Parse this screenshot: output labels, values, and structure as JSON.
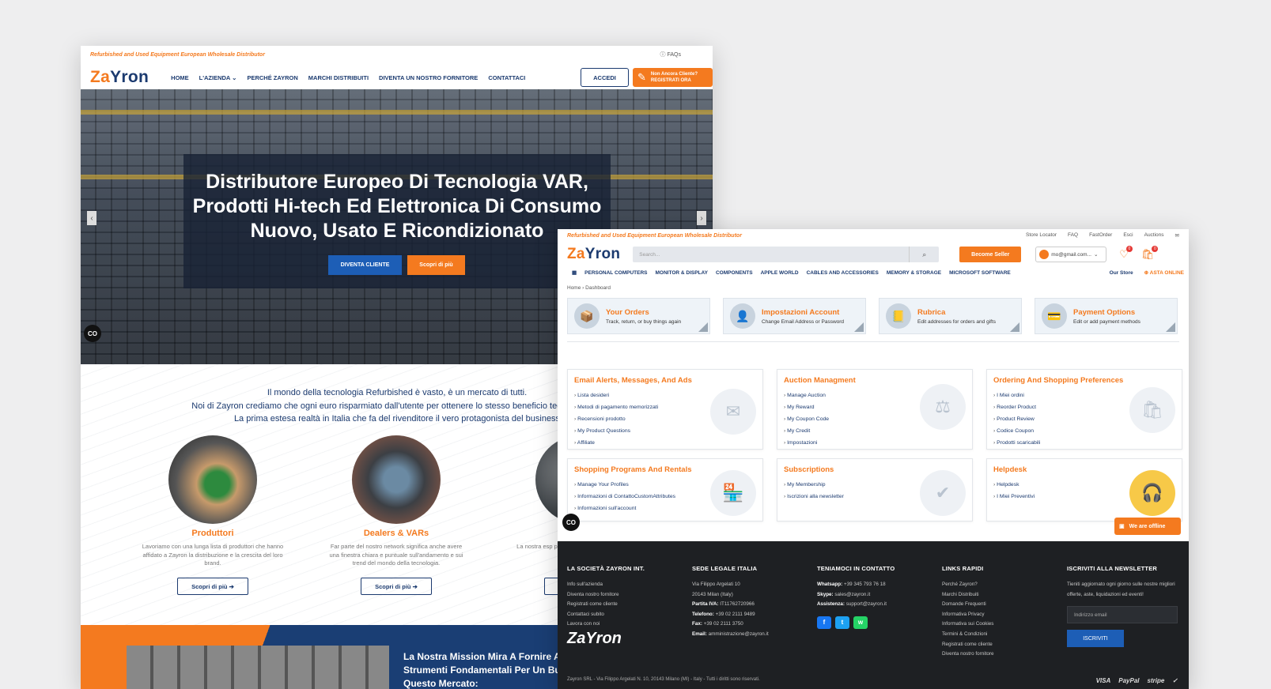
{
  "w1": {
    "tagline": "Refurbished and Used Equipment European Wholesale Distributor",
    "faq": "FAQs",
    "logo": {
      "a": "Za",
      "b": "Yron"
    },
    "menu": [
      "HOME",
      "L'AZIENDA ⌄",
      "PERCHÉ ZAYRON",
      "MARCHI DISTRIBUITI",
      "DIVENTA UN NOSTRO FORNITORE",
      "CONTATTACI"
    ],
    "accedi": "ACCEDI",
    "register": {
      "line1": "Non Ancora Cliente?",
      "line2": "REGISTRATI ORA"
    },
    "hero": {
      "title": "Distributore Europeo Di Tecnologia VAR, Prodotti Hi-tech Ed Elettronica Di Consumo Nuovo, Usato E Ricondizionato",
      "btn_primary": "DIVENTA CLIENTE",
      "btn_secondary": "Scopri di più",
      "prev": "‹",
      "next": "›"
    },
    "cc": "CO",
    "intro": {
      "line1": "Il mondo della tecnologia Refurbished è vasto, è un mercato di tutti.",
      "line2": "Noi di Zayron crediamo che ogni euro risparmiato dall'utente per ottenere lo stesso beneficio tecnologico si",
      "line3": "La prima estesa realtà in Italia che fa del rivenditore il vero protagonista del business"
    },
    "columns": [
      {
        "title": "Produttori",
        "text": "Lavoriamo con una lunga lista di produttori che hanno affidato a Zayron la distribuzione e la crescita del loro brand.",
        "btn": "Scopri di più ➔"
      },
      {
        "title": "Dealers & VARs",
        "text": "Far parte del nostro network significa anche avere una finestra chiara e puntuale sull'andamento e sui trend del mondo della tecnologia.",
        "btn": "Scopri di più ➔"
      },
      {
        "title": "Ute",
        "text": "La nostra esp portafoglio pr nostro valore sempr",
        "btn": ""
      }
    ],
    "mission": {
      "line1": "La Nostra Mission Mira A Fornire All'o",
      "line2": "Strumenti Fondamentali Per Un Busin",
      "line3": "Questo Mercato:"
    }
  },
  "w2": {
    "tagline": "Refurbished and Used Equipment European Wholesale Distributor",
    "toplinks": [
      "Store Locator",
      "FAQ",
      "FastOrder",
      "Esci",
      "Auctions",
      "✉"
    ],
    "logo": {
      "a": "Za",
      "b": "Yron"
    },
    "search_placeholder": "Search...",
    "seller": "Become Seller",
    "account": "mo@gmail.com...",
    "wish_count": "0",
    "cart_count": "0",
    "cats": [
      "PERSONAL COMPUTERS",
      "MONITOR & DISPLAY",
      "COMPONENTS",
      "APPLE WORLD",
      "CABLES AND ACCESSORIES",
      "MEMORY & STORAGE",
      "MICROSOFT SOFTWARE"
    ],
    "our_store": "Our Store",
    "asta": "ASTA ONLINE",
    "breadcrumb": {
      "home": "Home",
      "sep": "›",
      "current": "Dashboard"
    },
    "tiles": [
      {
        "title": "Your Orders",
        "sub": "Track, return, or buy things again",
        "icon": "📦"
      },
      {
        "title": "Impostazioni Account",
        "sub": "Change Email Address or Password",
        "icon": "👤"
      },
      {
        "title": "Rubrica",
        "sub": "Edit addresses for orders and gifts",
        "icon": "📒"
      },
      {
        "title": "Payment Options",
        "sub": "Edit or add payment methods",
        "icon": "💳"
      }
    ],
    "cards": [
      {
        "title": "Email Alerts, Messages, And Ads",
        "items": [
          "Lista desideri",
          "Metodi di pagamento memorizzati",
          "Recensioni prodotto",
          "My Product Questions",
          "Affiliate"
        ],
        "icon": "✉"
      },
      {
        "title": "Auction Managment",
        "items": [
          "Manage Auction",
          "My Reward",
          "My Coupon Code",
          "My Credit",
          "Impostazioni"
        ],
        "icon": "⚖"
      },
      {
        "title": "Ordering And Shopping Preferences",
        "items": [
          "I Miei ordini",
          "Reorder Product",
          "Product Review",
          "Codice Coupon",
          "Prodotti scaricabili"
        ],
        "icon": "🛍"
      },
      {
        "title": "Shopping Programs And Rentals",
        "items": [
          "Manage Your Profiles",
          "Informazioni di ContattoCustomAttributes",
          "Informazioni sull'account"
        ],
        "icon": "🏪"
      },
      {
        "title": "Subscriptions",
        "items": [
          "My Membership",
          "Iscrizioni alla newsletter"
        ],
        "icon": "✔"
      },
      {
        "title": "Helpdesk",
        "items": [
          "Helpdesk",
          "I Miei Preventivi"
        ],
        "icon": "🎧"
      }
    ],
    "offline": "We are offline",
    "footer": {
      "col1": {
        "title": "LA SOCIETÀ ZAYRON INT.",
        "links": [
          "Info sull'azienda",
          "Diventa nostro fornitore",
          "Registrati come cliente",
          "Contattaci subito",
          "Lavora con noi"
        ]
      },
      "col2": {
        "title": "SEDE LEGALE ITALIA",
        "lines": [
          "Via Filippo Argelati 10",
          "20143 Milan (Italy)"
        ],
        "piva_label": "Partita IVA:",
        "piva": "IT11762720966",
        "tel_label": "Telefono:",
        "tel": "+39 02 2111 9489",
        "fax_label": "Fax:",
        "fax": "+39 02 2111 3750",
        "email_label": "Email:",
        "email": "amministrazione@zayron.it"
      },
      "col3": {
        "title": "TENIAMOCI IN CONTATTO",
        "wa_label": "Whatsapp:",
        "wa": "+39 345 793 76 18",
        "sk_label": "Skype:",
        "sk": "sales@zayron.it",
        "as_label": "Assistenza:",
        "as": "support@zayron.it",
        "social": [
          "f",
          "t",
          "w"
        ]
      },
      "col4": {
        "title": "LINKS RAPIDI",
        "links": [
          "Perché Zayron?",
          "Marchi Distribuiti",
          "Domande Frequenti",
          "Informativa Privacy",
          "Informativa sui Cookies",
          "Termini & Condizioni",
          "Registrati come cliente",
          "Diventa nostro fornitore"
        ]
      },
      "col5": {
        "title": "ISCRIVITI ALLA NEWSLETTER",
        "text": "Tieniti aggiornato ogni giorno sulle nostre migliori offerte, aste, liquidazioni ed eventi!",
        "placeholder": "Indirizzo email",
        "btn": "ISCRIVITI"
      },
      "logo": "ZaYron",
      "copyright": "Zayron SRL - Via Filippo Argelati N. 10, 20143 Milano (MI) - Italy - Tutti i diritti sono riservati.",
      "payments": [
        "VISA",
        "PayPal",
        "stripe",
        "✓"
      ]
    },
    "colors": {
      "accent": "#f47a1f",
      "brand": "#1b3a6f",
      "footer": "#1e2023"
    }
  }
}
